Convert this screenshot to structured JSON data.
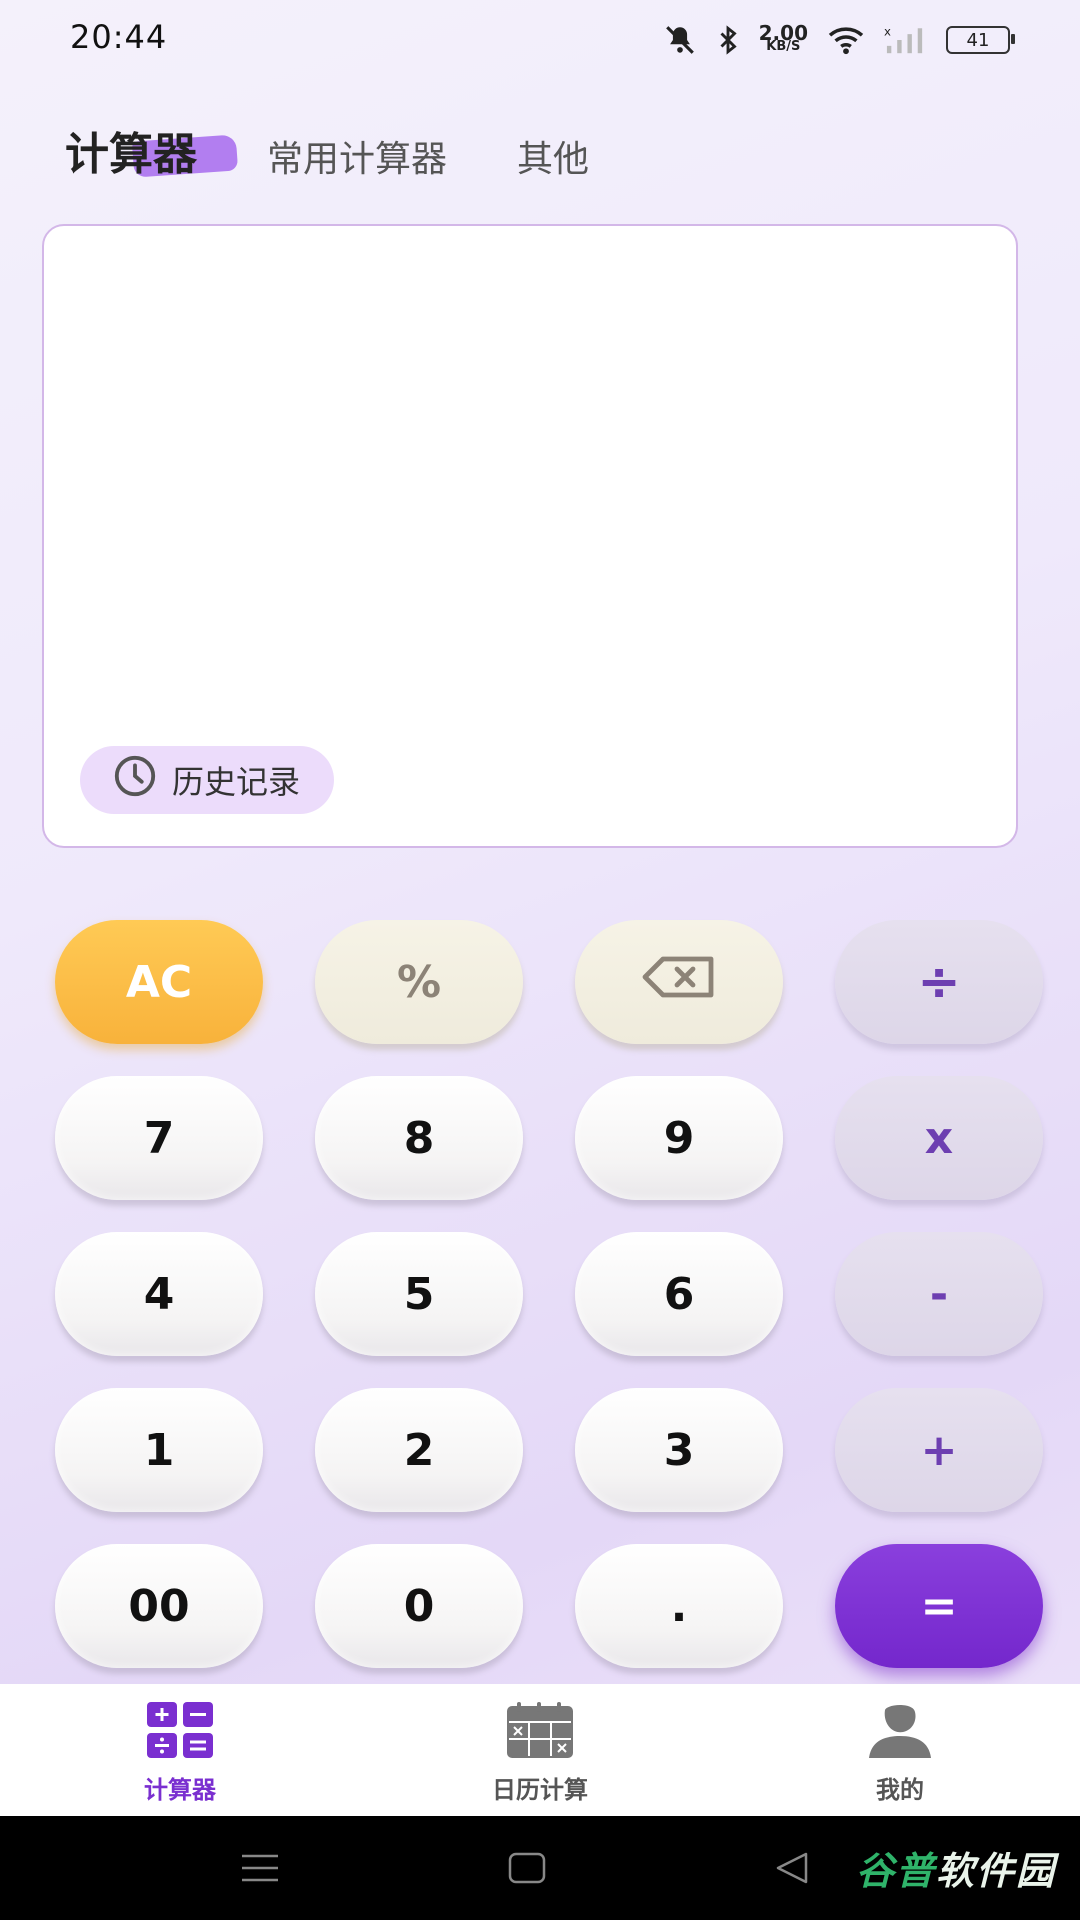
{
  "status_bar": {
    "time": "20:44",
    "net_speed_value": "2.00",
    "net_speed_unit": "KB/S",
    "battery": "41",
    "icons": [
      "mute-bell-icon",
      "bluetooth-icon",
      "wifi-icon",
      "signal-icon",
      "battery-icon"
    ]
  },
  "tabs": [
    {
      "label": "计算器",
      "active": true
    },
    {
      "label": "常用计算器",
      "active": false
    },
    {
      "label": "其他",
      "active": false
    }
  ],
  "display": {
    "expression": "",
    "history_label": "历史记录"
  },
  "keys": {
    "ac": "AC",
    "percent": "%",
    "divide": "÷",
    "k7": "7",
    "k8": "8",
    "k9": "9",
    "multiply": "x",
    "k4": "4",
    "k5": "5",
    "k6": "6",
    "minus": "-",
    "k1": "1",
    "k2": "2",
    "k3": "3",
    "plus": "+",
    "k00": "00",
    "k0": "0",
    "dot": ".",
    "equals": "="
  },
  "bottom_nav": [
    {
      "label": "计算器",
      "icon": "calculator-icon",
      "active": true
    },
    {
      "label": "日历计算",
      "icon": "calendar-icon",
      "active": false
    },
    {
      "label": "我的",
      "icon": "profile-icon",
      "active": false
    }
  ],
  "watermark": {
    "part1": "谷普",
    "part2": "软件园"
  },
  "colors": {
    "accent": "#7a2fd0",
    "ac_key": "#f8b23b",
    "equals_key": "#7427cc",
    "operator_text": "#6d3fb1"
  }
}
